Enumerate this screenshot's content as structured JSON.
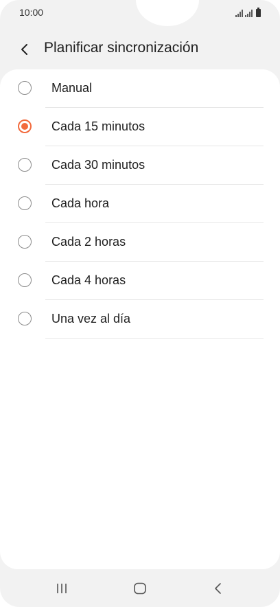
{
  "status_bar": {
    "time": "10:00",
    "icons": [
      "signal-icon",
      "signal-icon",
      "battery-icon"
    ]
  },
  "header": {
    "title": "Planificar sincronización",
    "back_icon": "chevron-left-icon"
  },
  "options": [
    {
      "label": "Manual",
      "selected": false
    },
    {
      "label": "Cada 15 minutos",
      "selected": true
    },
    {
      "label": "Cada 30 minutos",
      "selected": false
    },
    {
      "label": "Cada hora",
      "selected": false
    },
    {
      "label": "Cada 2 horas",
      "selected": false
    },
    {
      "label": "Cada 4 horas",
      "selected": false
    },
    {
      "label": "Una vez al día",
      "selected": false
    }
  ],
  "nav_bar": {
    "icons": [
      "recent-apps-icon",
      "home-icon",
      "back-icon"
    ]
  },
  "colors": {
    "accent": "#f26a3d",
    "background": "#f2f2f2",
    "card": "#ffffff"
  }
}
